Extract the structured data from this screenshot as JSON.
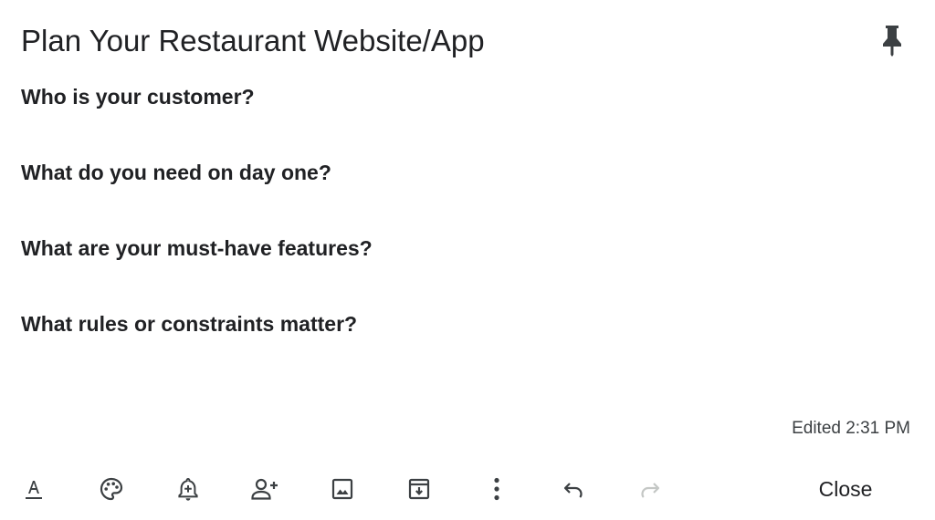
{
  "note": {
    "title": "Plan Your Restaurant Website/App",
    "questions": [
      "Who is your customer?",
      "What do you need on day one?",
      "What are your must-have features?",
      "What rules or constraints matter?"
    ],
    "edited": "Edited 2:31 PM"
  },
  "toolbar": {
    "icons": [
      "text-format-icon",
      "palette-icon",
      "reminder-bell-icon",
      "add-collaborator-icon",
      "add-image-icon",
      "archive-icon",
      "more-options-icon",
      "undo-icon",
      "redo-icon"
    ],
    "close_label": "Close"
  },
  "colors": {
    "icon": "#3c4043",
    "icon_disabled": "#c4c7c5",
    "text": "#202124"
  }
}
